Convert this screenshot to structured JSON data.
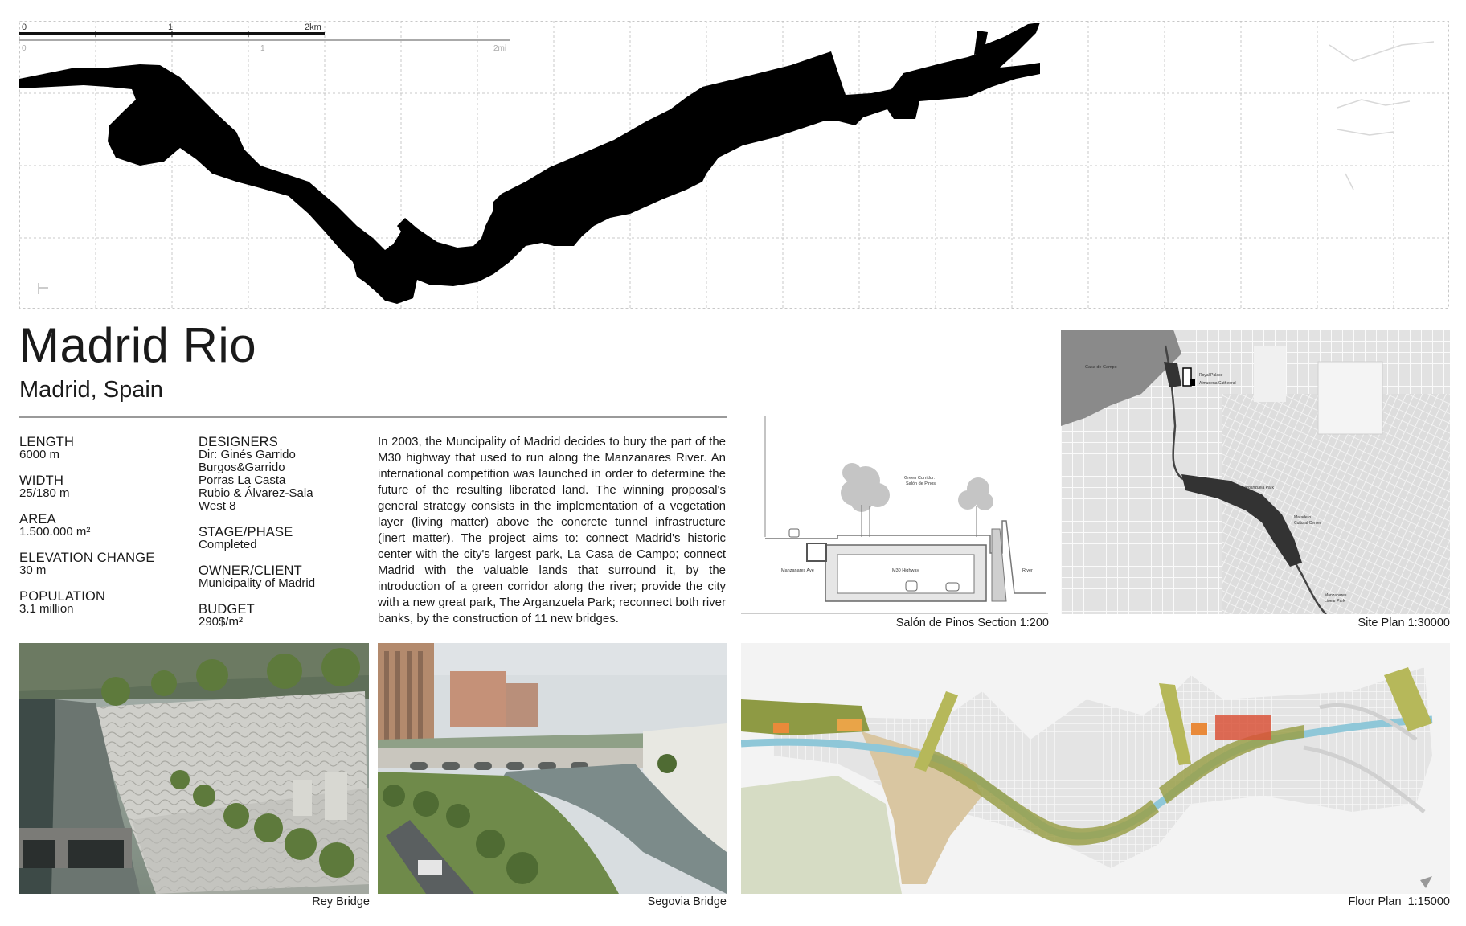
{
  "scale": {
    "km_ticks": [
      "0",
      "1",
      "2km"
    ],
    "mi_ticks": [
      "0",
      "1",
      "2mi"
    ]
  },
  "project": {
    "title": "Madrid Rio",
    "location": "Madrid, Spain"
  },
  "specs_left": [
    {
      "label": "LENGTH",
      "value": "6000 m"
    },
    {
      "label": "WIDTH",
      "value": "25/180 m"
    },
    {
      "label": "AREA",
      "value": "1.500.000 m²"
    },
    {
      "label": "ELEVATION CHANGE",
      "value": "30 m"
    },
    {
      "label": "POPULATION",
      "value": "3.1 million"
    }
  ],
  "specs_right": [
    {
      "label": "DESIGNERS",
      "value": "Dir: Ginés Garrido\nBurgos&Garrido\nPorras La Casta\nRubio & Álvarez-Sala\nWest 8"
    },
    {
      "label": "STAGE/PHASE",
      "value": "Completed"
    },
    {
      "label": "OWNER/CLIENT",
      "value": "Municipality of Madrid"
    },
    {
      "label": "BUDGET",
      "value": "290$/m²"
    }
  ],
  "description": "In 2003, the Muncipality of Madrid decides to bury the part of the M30 highway that used to run along the Manzanares River. An international competition was launched in order to determine the future of the resulting liberated land. The winning proposal's general strategy consists in the implementation of a vegetation layer (living matter) above the concrete tunnel infrastructure (inert matter). The project aims to: connect Madrid's historic center with the city's largest park, La Casa de Campo; connect Madrid with the valuable lands that surround it, by the introduction of a green corridor along the river; provide the city with a new great park, The Arganzuela Park; reconnect both river banks, by the construction of 11 new bridges.",
  "section": {
    "caption": "Salón de Pinos Section 1:200",
    "labels": {
      "green_corridor": "Green Corridor:",
      "green_corridor_2": "Salón de Pinos",
      "avenue": "Manzanares Ave",
      "highway": "M30 Highway",
      "river": "River"
    }
  },
  "site_plan": {
    "caption": "Site Plan 1:30000",
    "labels": {
      "casa": "Casa de Campo",
      "palace": "Royal Palace",
      "cathedral": "Almudena Cathedral",
      "arganzuela": "Arganzuela Park",
      "matadero": "Matadero",
      "matadero_2": "Cultural Center",
      "linear": "Manzanares",
      "linear_2": "Linear Park"
    }
  },
  "photos": [
    {
      "caption": "Rey Bridge"
    },
    {
      "caption": "Segovia Bridge"
    }
  ],
  "floor_plan": {
    "caption": "Floor Plan  1:15000"
  },
  "colors": {
    "silhouette": "#000000",
    "grid": "#c8c8c8",
    "river": "#8fc7d8",
    "park_green": "#9aa04a",
    "accent_red": "#d9533a"
  }
}
